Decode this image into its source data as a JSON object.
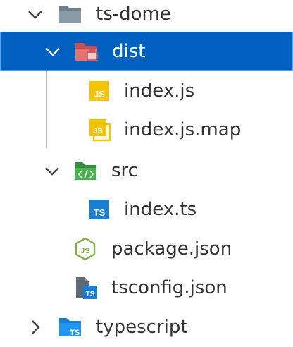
{
  "explorer": {
    "items": [
      {
        "label": "ts-dome",
        "icon": "folder-open-icon",
        "expanded": true
      },
      {
        "label": "dist",
        "icon": "folder-dist-open-icon",
        "expanded": true,
        "selected": true
      },
      {
        "label": "index.js",
        "icon": "javascript-file-icon"
      },
      {
        "label": "index.js.map",
        "icon": "javascript-map-file-icon"
      },
      {
        "label": "src",
        "icon": "folder-src-open-icon",
        "expanded": true
      },
      {
        "label": "index.ts",
        "icon": "typescript-file-icon"
      },
      {
        "label": "package.json",
        "icon": "nodejs-file-icon"
      },
      {
        "label": "tsconfig.json",
        "icon": "tsconfig-file-icon"
      },
      {
        "label": "typescript",
        "icon": "folder-typescript-icon",
        "expanded": false
      }
    ]
  },
  "colors": {
    "selection": "#0060c0",
    "selection_border": "#5aa0e6",
    "folder_grey": "#8a9aa6",
    "folder_dist": "#e57373",
    "folder_src": "#4caf50",
    "js_yellow": "#f5c400",
    "ts_blue": "#1a7fd0",
    "node_green": "#7cb342"
  }
}
